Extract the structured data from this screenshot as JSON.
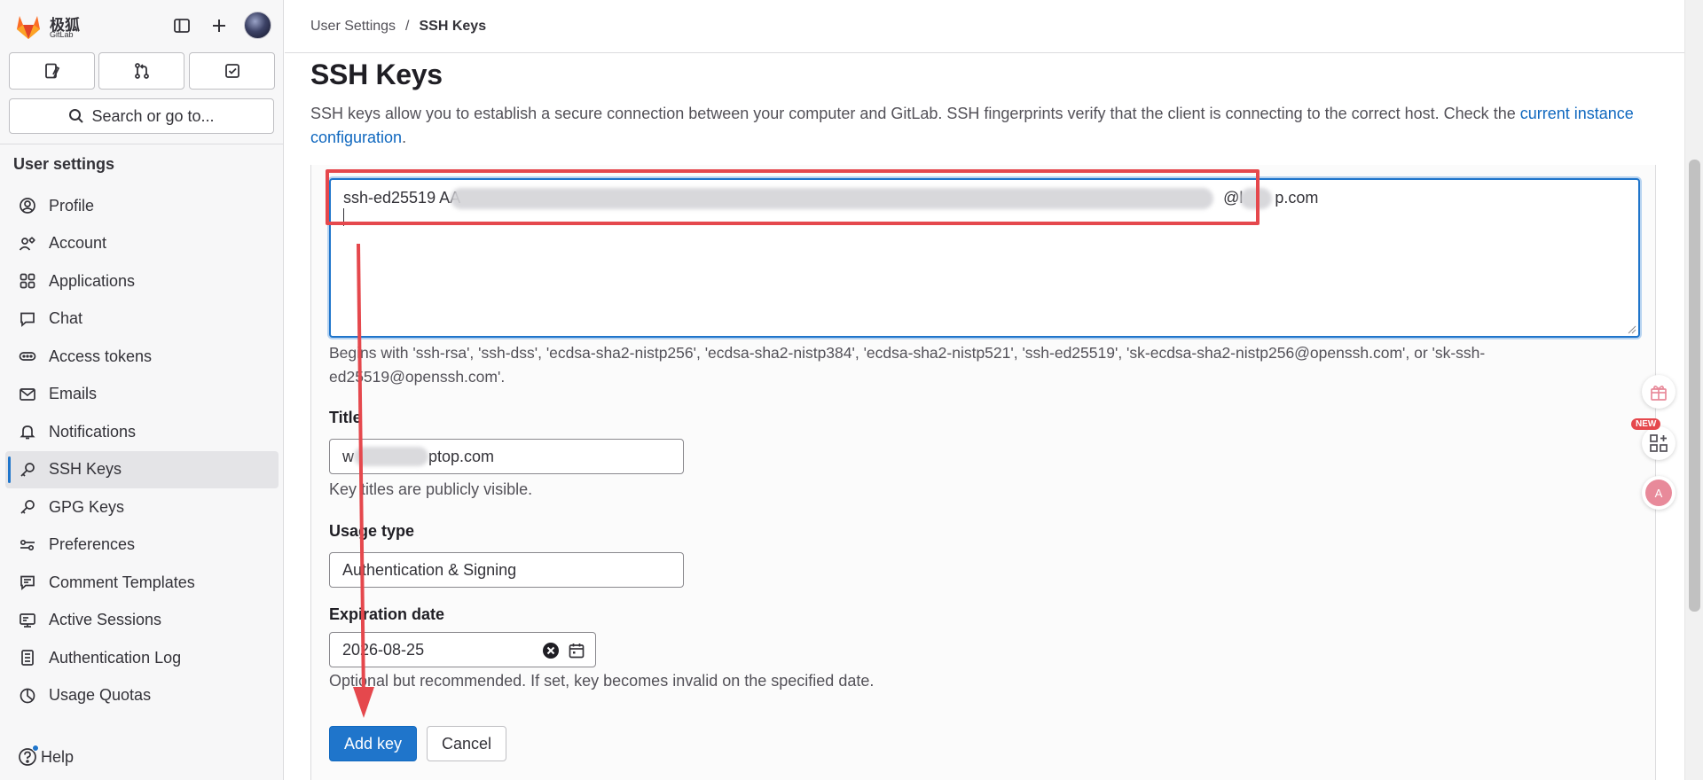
{
  "brand": {
    "name_cn": "极狐",
    "name_en": "GitLab"
  },
  "sidebar": {
    "search_label": "Search or go to...",
    "heading": "User settings",
    "items": [
      {
        "label": "Profile",
        "icon": "user-icon"
      },
      {
        "label": "Account",
        "icon": "account-icon"
      },
      {
        "label": "Applications",
        "icon": "applications-icon"
      },
      {
        "label": "Chat",
        "icon": "comment-icon"
      },
      {
        "label": "Access tokens",
        "icon": "token-icon"
      },
      {
        "label": "Emails",
        "icon": "mail-icon"
      },
      {
        "label": "Notifications",
        "icon": "bell-icon"
      },
      {
        "label": "SSH Keys",
        "icon": "key-icon",
        "active": true
      },
      {
        "label": "GPG Keys",
        "icon": "key-icon"
      },
      {
        "label": "Preferences",
        "icon": "preferences-icon"
      },
      {
        "label": "Comment Templates",
        "icon": "comment-lines-icon"
      },
      {
        "label": "Active Sessions",
        "icon": "monitor-icon"
      },
      {
        "label": "Authentication Log",
        "icon": "log-icon"
      },
      {
        "label": "Usage Quotas",
        "icon": "quota-icon"
      }
    ],
    "help_label": "Help"
  },
  "breadcrumb": {
    "parent": "User Settings",
    "separator": "/",
    "current": "SSH Keys"
  },
  "page": {
    "title": "SSH Keys",
    "description": "SSH keys allow you to establish a secure connection between your computer and GitLab. SSH fingerprints verify that the client is connecting to the correct host. Check the ",
    "description_link": "current instance configuration",
    "description_end": "."
  },
  "form": {
    "key_value_start": "ssh-ed25519 AA",
    "key_value_end": "@l",
    "key_value_tail": "p.com",
    "key_hint": "Begins with 'ssh-rsa', 'ssh-dss', 'ecdsa-sha2-nistp256', 'ecdsa-sha2-nistp384', 'ecdsa-sha2-nistp521', 'ssh-ed25519', 'sk-ecdsa-sha2-nistp256@openssh.com', or 'sk-ssh-ed25519@openssh.com'.",
    "title_label": "Title",
    "title_value_start": "w",
    "title_value_end": "ptop.com",
    "title_hint": "Key titles are publicly visible.",
    "usage_label": "Usage type",
    "usage_value": "Authentication & Signing",
    "expiry_label": "Expiration date",
    "expiry_value": "2026-08-25",
    "expiry_hint": "Optional but recommended. If set, key becomes invalid on the specified date.",
    "add_button": "Add key",
    "cancel_button": "Cancel"
  },
  "floating": {
    "new_badge": "NEW"
  },
  "colors": {
    "primary": "#1f75cb",
    "annotation": "#e5484d",
    "link": "#1068bf"
  }
}
